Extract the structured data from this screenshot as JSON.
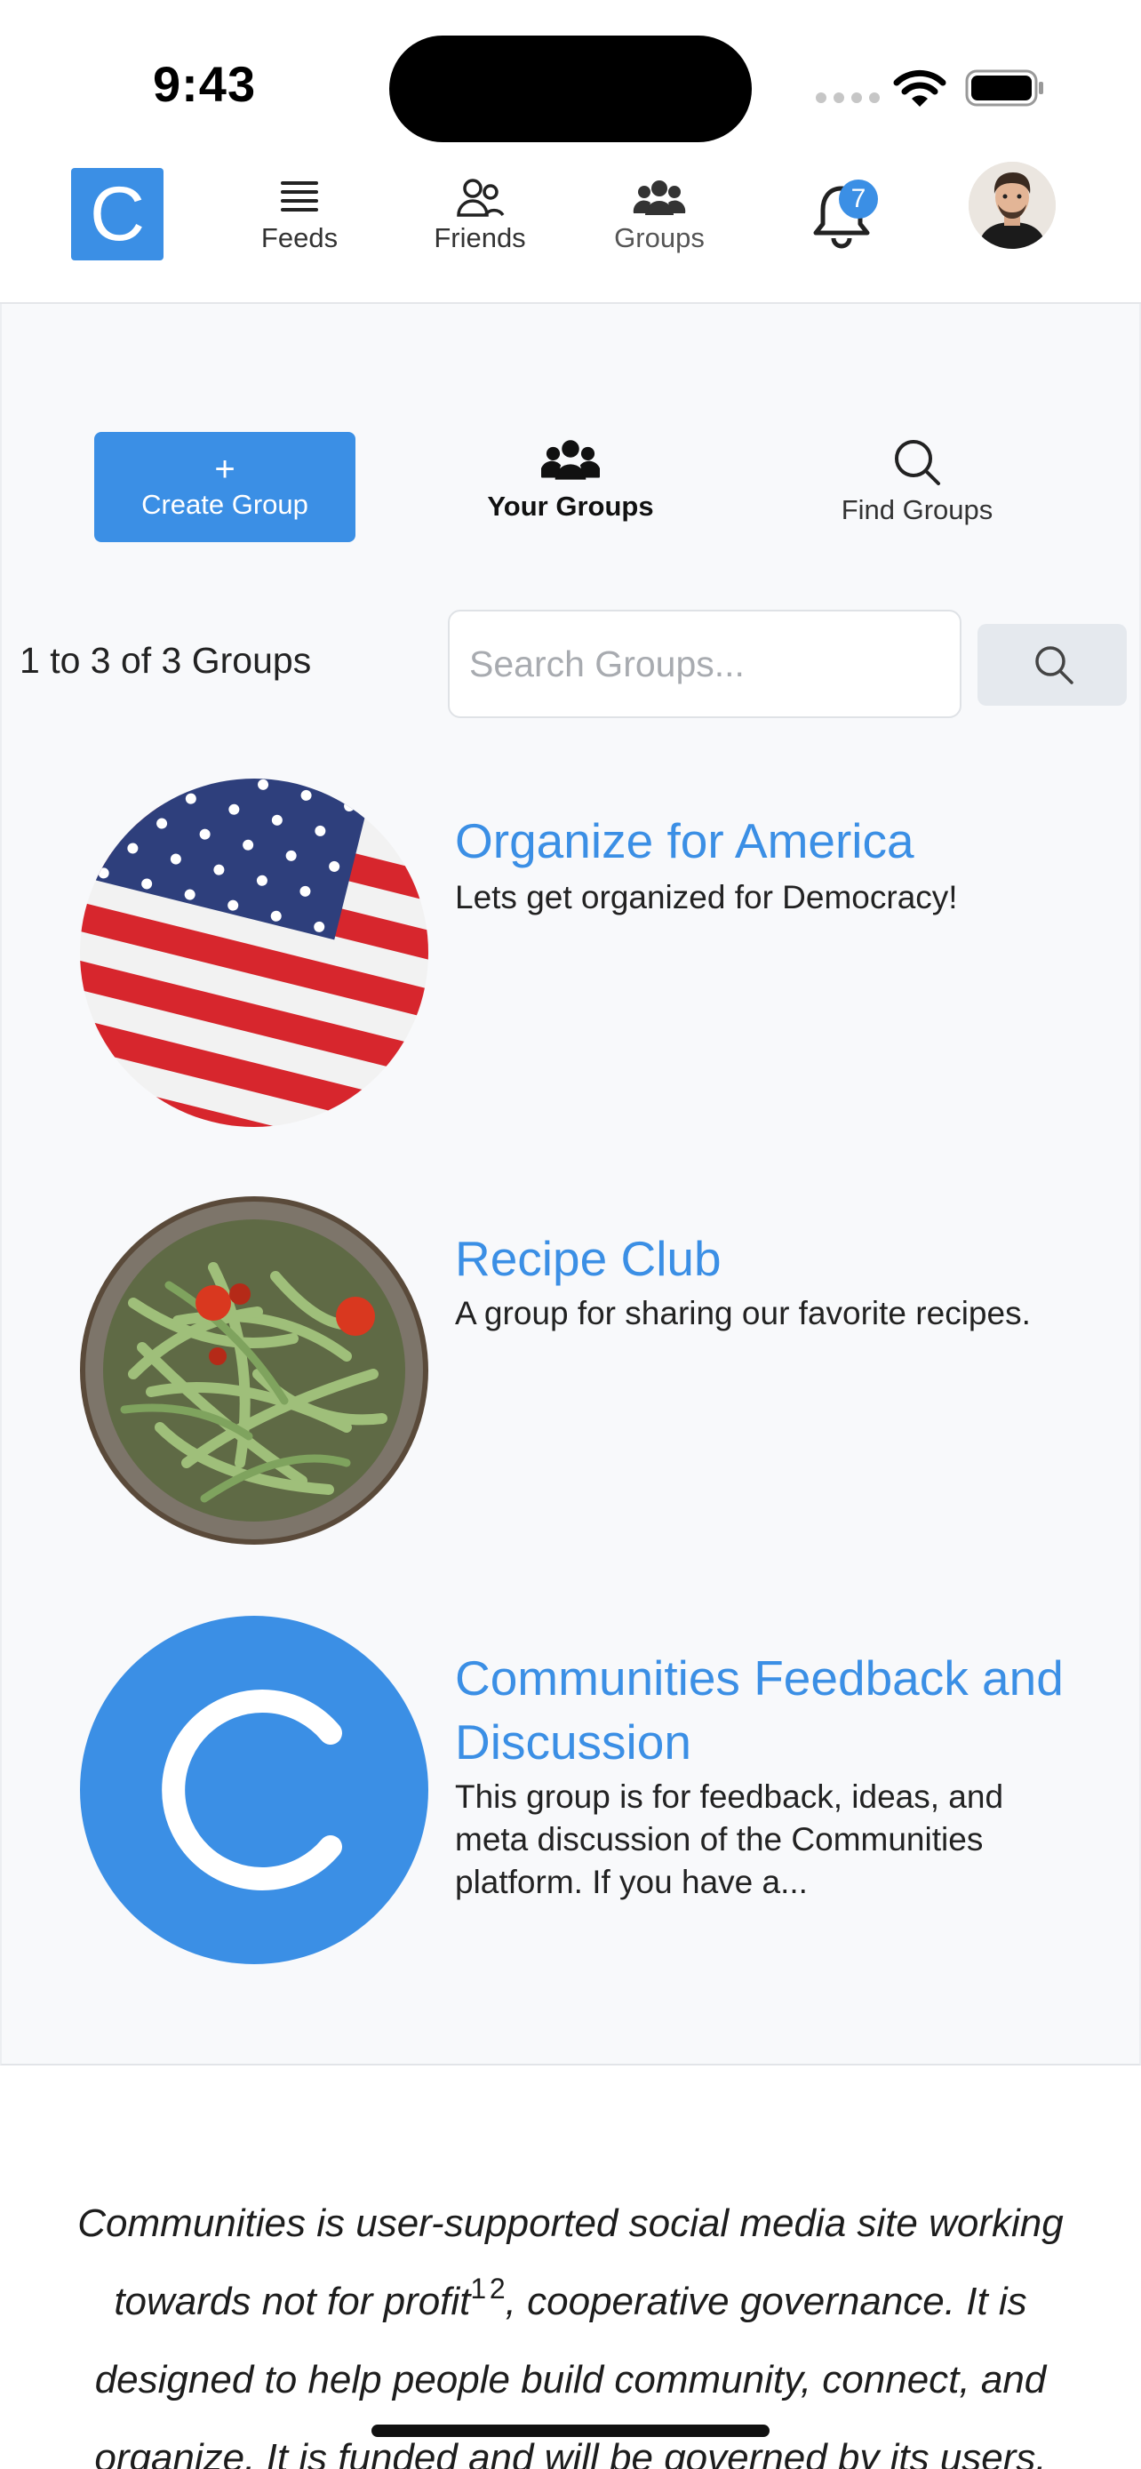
{
  "status_bar": {
    "time": "9:43"
  },
  "brand": {
    "logo_letter": "C",
    "accent": "#3b8fe5"
  },
  "nav": {
    "feeds": "Feeds",
    "friends": "Friends",
    "groups": "Groups",
    "notification_count": "7"
  },
  "actions": {
    "create_plus": "+",
    "create_group": "Create Group",
    "your_groups": "Your Groups",
    "find_groups": "Find Groups"
  },
  "results": {
    "count_text": "1 to 3 of 3 Groups",
    "search_placeholder": "Search Groups..."
  },
  "groups": [
    {
      "name": "Organize for America",
      "description": "Lets get organized for Democracy!",
      "image": "american-flag"
    },
    {
      "name": "Recipe Club",
      "description": "A group for sharing our favorite recipes.",
      "image": "green-beans-bowl"
    },
    {
      "name": "Communities Feedback and Discussion",
      "description": "This group is for feedback, ideas, and meta discussion of the Communities platform. If you have a...",
      "image": "communities-logo",
      "logo_letter": "C"
    }
  ],
  "footer": {
    "part1": "Communities is user-supported social media site working towards not for profit",
    "sup1": "1",
    "sup2": "2",
    "part2": ", cooperative governance. It is designed to help people build community, connect, and organize. It is funded and will be governed by its users."
  }
}
